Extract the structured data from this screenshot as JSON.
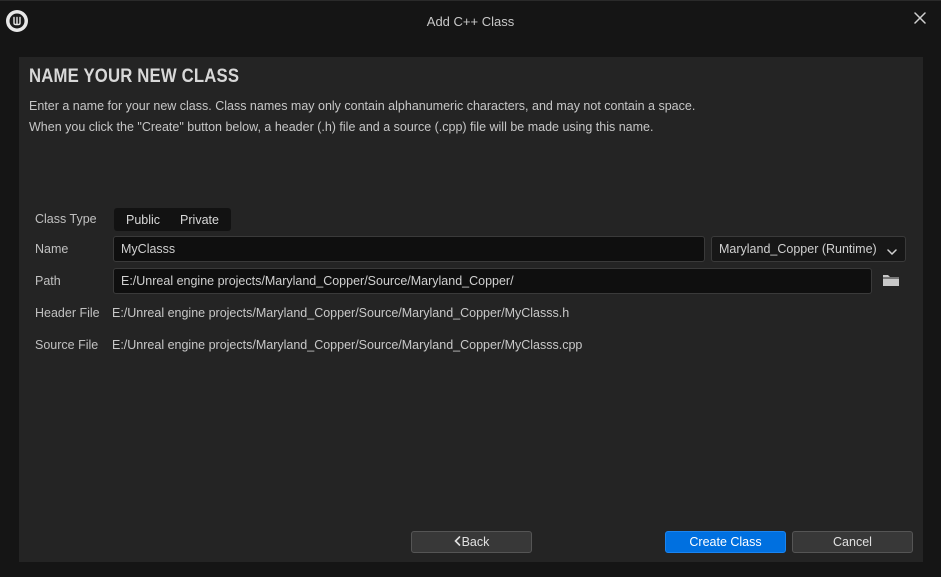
{
  "window": {
    "title": "Add C++ Class",
    "logo_icon": "unreal-logo-icon",
    "close_icon": "close-icon"
  },
  "heading": "NAME YOUR NEW CLASS",
  "description": {
    "line1": "Enter a name for your new class. Class names may only contain alphanumeric characters, and may not contain a space.",
    "line2": "When you click the \"Create\" button below, a header (.h) file and a source (.cpp) file will be made using this name."
  },
  "form": {
    "class_type": {
      "label": "Class Type",
      "options": [
        "Public",
        "Private"
      ]
    },
    "name": {
      "label": "Name",
      "value": "MyClasss"
    },
    "module": {
      "selected": "Maryland_Copper (Runtime)",
      "icon": "chevron-down-icon"
    },
    "path": {
      "label": "Path",
      "value": "E:/Unreal engine projects/Maryland_Copper/Source/Maryland_Copper/",
      "browse_icon": "folder-icon"
    },
    "header_file": {
      "label": "Header File",
      "value": "E:/Unreal engine projects/Maryland_Copper/Source/Maryland_Copper/MyClasss.h"
    },
    "source_file": {
      "label": "Source File",
      "value": "E:/Unreal engine projects/Maryland_Copper/Source/Maryland_Copper/MyClasss.cpp"
    }
  },
  "buttons": {
    "back": "Back",
    "create": "Create Class",
    "cancel": "Cancel"
  },
  "colors": {
    "accent": "#0070e0",
    "panel_bg": "#242424",
    "window_bg": "#151515"
  }
}
